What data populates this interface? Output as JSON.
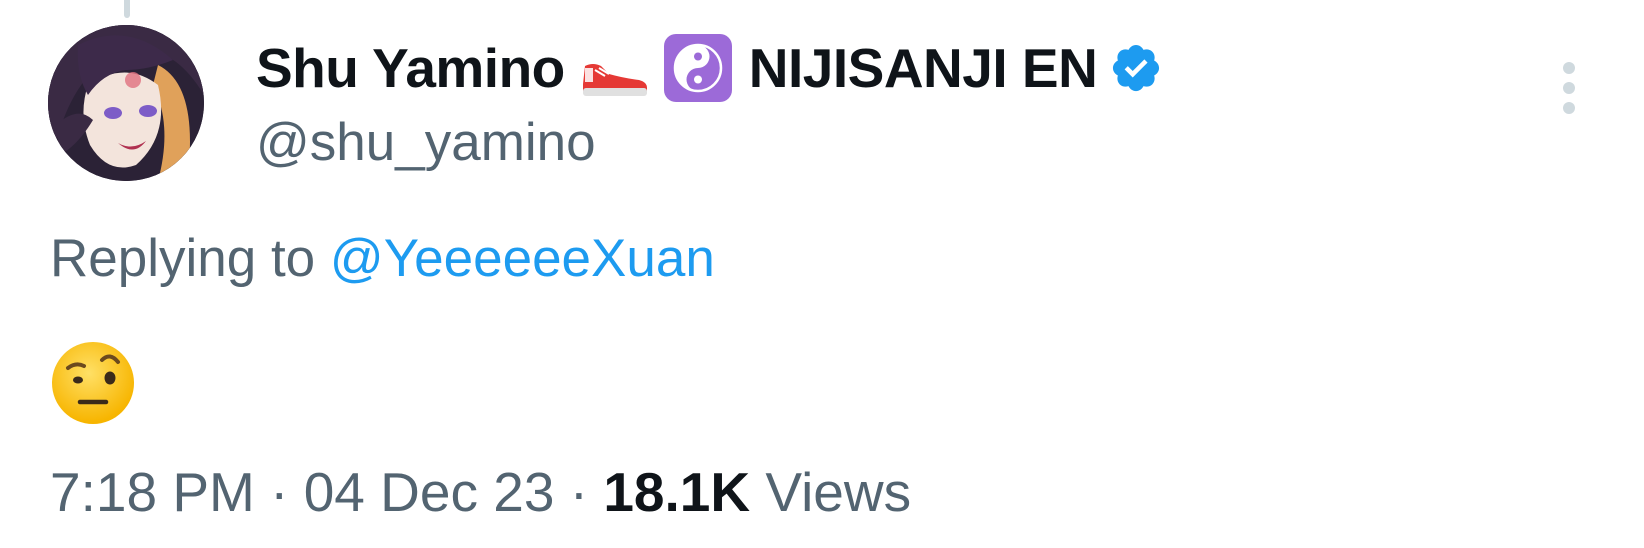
{
  "tweet": {
    "author": {
      "display_name": "Shu Yamino",
      "emojis": [
        "sneaker-emoji",
        "yin-yang-emoji"
      ],
      "org_name": "NIJISANJI EN",
      "handle": "@shu_yamino",
      "verified": true
    },
    "reply": {
      "prefix": "Replying to",
      "mention": "@YeeeeeeXuan"
    },
    "body_emoji": "face-with-raised-eyebrow-emoji",
    "meta": {
      "time": "7:18 PM",
      "separator": "·",
      "date": "04 Dec 23",
      "views_count": "18.1K",
      "views_label": "Views"
    }
  },
  "colors": {
    "text_primary": "#0f1419",
    "text_secondary": "#536471",
    "link": "#1d9bf0",
    "verified": "#1d9bf0"
  }
}
